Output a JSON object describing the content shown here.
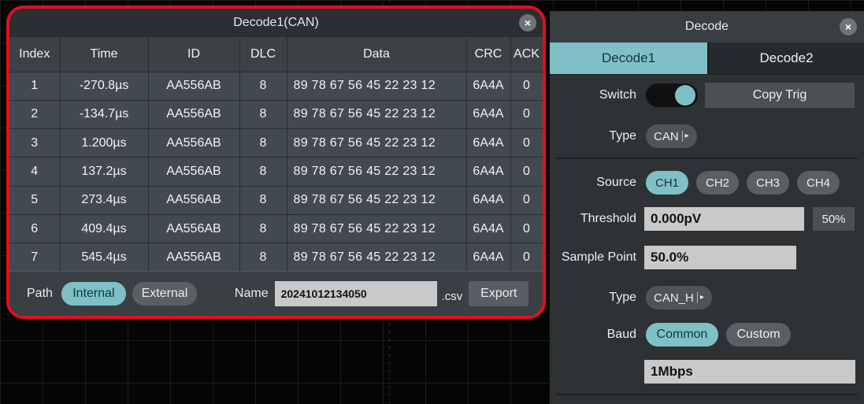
{
  "table_window": {
    "title": "Decode1(CAN)",
    "close_glyph": "×",
    "columns": [
      "Index",
      "Time",
      "ID",
      "DLC",
      "Data",
      "CRC",
      "ACK"
    ],
    "rows": [
      [
        "1",
        "-270.8µs",
        "AA556AB",
        "8",
        "89 78 67 56 45 22 23 12",
        "6A4A",
        "0"
      ],
      [
        "2",
        "-134.7µs",
        "AA556AB",
        "8",
        "89 78 67 56 45 22 23 12",
        "6A4A",
        "0"
      ],
      [
        "3",
        "1.200µs",
        "AA556AB",
        "8",
        "89 78 67 56 45 22 23 12",
        "6A4A",
        "0"
      ],
      [
        "4",
        "137.2µs",
        "AA556AB",
        "8",
        "89 78 67 56 45 22 23 12",
        "6A4A",
        "0"
      ],
      [
        "5",
        "273.4µs",
        "AA556AB",
        "8",
        "89 78 67 56 45 22 23 12",
        "6A4A",
        "0"
      ],
      [
        "6",
        "409.4µs",
        "AA556AB",
        "8",
        "89 78 67 56 45 22 23 12",
        "6A4A",
        "0"
      ],
      [
        "7",
        "545.4µs",
        "AA556AB",
        "8",
        "89 78 67 56 45 22 23 12",
        "6A4A",
        "0"
      ]
    ],
    "footer": {
      "path_label": "Path",
      "path_options": [
        "Internal",
        "External"
      ],
      "path_selected": "Internal",
      "name_label": "Name",
      "name_value": "20241012134050",
      "extension": ".csv",
      "export_label": "Export"
    },
    "highlight_color": "#e0101b"
  },
  "decode_panel": {
    "title": "Decode",
    "close_glyph": "×",
    "tabs": [
      "Decode1",
      "Decode2"
    ],
    "active_tab": "Decode1",
    "switch_label": "Switch",
    "switch_on": true,
    "copy_trig_label": "Copy Trig",
    "type_label": "Type",
    "type_value": "CAN",
    "source_label": "Source",
    "sources": [
      "CH1",
      "CH2",
      "CH3",
      "CH4"
    ],
    "source_selected": "CH1",
    "threshold_label": "Threshold",
    "threshold_value": "0.000pV",
    "threshold_pct_label": "50%",
    "sample_point_label": "Sample Point",
    "sample_point_value": "50.0%",
    "signal_type_label": "Type",
    "signal_type_value": "CAN_H",
    "baud_label": "Baud",
    "baud_options": [
      "Common",
      "Custom"
    ],
    "baud_selected": "Common",
    "baud_value": "1Mbps",
    "accent_color": "#7fc0c7"
  }
}
